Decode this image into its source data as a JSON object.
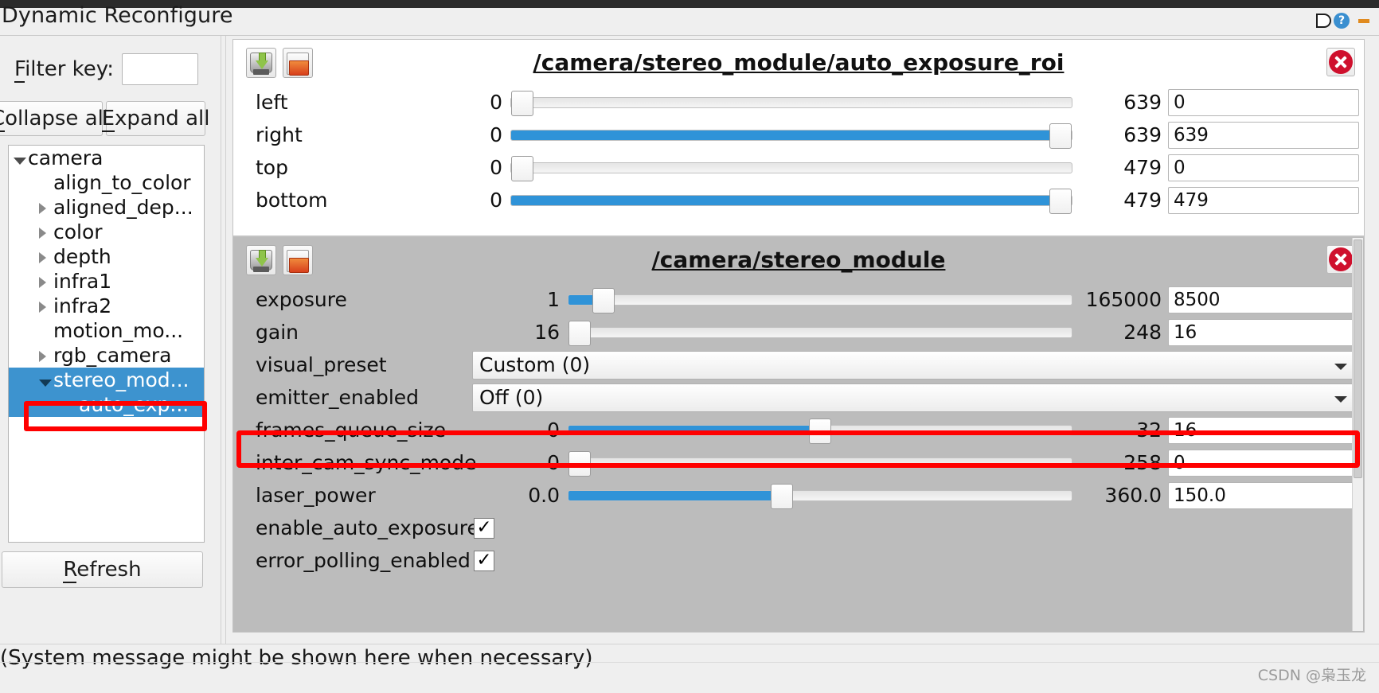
{
  "window": {
    "title": "Dynamic Reconfigure",
    "float_icon": "float-window-icon",
    "help_icon": "help-icon",
    "help_glyph": "?"
  },
  "sidebar": {
    "filter_label": "Filter key:",
    "filter_value": "",
    "filter_placeholder": "",
    "collapse_label": "Collapse all",
    "expand_label": "Expand all",
    "refresh_label": "Refresh",
    "tree": [
      {
        "label": "camera",
        "indent": 0,
        "toggle": "down",
        "selected": false
      },
      {
        "label": "align_to_color",
        "indent": 1,
        "toggle": "none",
        "selected": false
      },
      {
        "label": "aligned_dep...",
        "indent": 1,
        "toggle": "right",
        "selected": false
      },
      {
        "label": "color",
        "indent": 1,
        "toggle": "right",
        "selected": false
      },
      {
        "label": "depth",
        "indent": 1,
        "toggle": "right",
        "selected": false
      },
      {
        "label": "infra1",
        "indent": 1,
        "toggle": "right",
        "selected": false
      },
      {
        "label": "infra2",
        "indent": 1,
        "toggle": "right",
        "selected": false
      },
      {
        "label": "motion_mo...",
        "indent": 1,
        "toggle": "none",
        "selected": false
      },
      {
        "label": "rgb_camera",
        "indent": 1,
        "toggle": "right",
        "selected": false
      },
      {
        "label": "stereo_mod...",
        "indent": 1,
        "toggle": "down",
        "selected": true
      },
      {
        "label": "auto_exp...",
        "indent": 2,
        "toggle": "none",
        "selected": true
      }
    ]
  },
  "groups": [
    {
      "title": "/camera/stereo_module/auto_exposure_roi",
      "save_icon": "save-disk-icon",
      "open_icon": "open-folder-icon",
      "close_icon": "close-icon",
      "rows": [
        {
          "kind": "slider",
          "name": "left",
          "min": "0",
          "max": "639",
          "value": "0",
          "pct": 0,
          "fill": 0
        },
        {
          "kind": "slider",
          "name": "right",
          "min": "0",
          "max": "639",
          "value": "639",
          "pct": 100,
          "fill": 100
        },
        {
          "kind": "slider",
          "name": "top",
          "min": "0",
          "max": "479",
          "value": "0",
          "pct": 0,
          "fill": 0
        },
        {
          "kind": "slider",
          "name": "bottom",
          "min": "0",
          "max": "479",
          "value": "479",
          "pct": 100,
          "fill": 100
        }
      ]
    },
    {
      "title": "/camera/stereo_module",
      "save_icon": "save-disk-icon",
      "open_icon": "open-folder-icon",
      "close_icon": "close-icon",
      "rows": [
        {
          "kind": "slider",
          "name": "exposure",
          "min": "1",
          "max": "165000",
          "value": "8500",
          "pct": 5,
          "fill": 5
        },
        {
          "kind": "slider",
          "name": "gain",
          "min": "16",
          "max": "248",
          "value": "16",
          "pct": 0,
          "fill": 0
        },
        {
          "kind": "combo",
          "name": "visual_preset",
          "value": "Custom (0)"
        },
        {
          "kind": "combo",
          "name": "emitter_enabled",
          "value": "Off (0)",
          "highlight": true
        },
        {
          "kind": "slider",
          "name": "frames_queue_size",
          "min": "0",
          "max": "32",
          "value": "16",
          "pct": 50,
          "fill": 50
        },
        {
          "kind": "slider",
          "name": "inter_cam_sync_mode",
          "min": "0",
          "max": "258",
          "value": "0",
          "pct": 0,
          "fill": 0
        },
        {
          "kind": "slider",
          "name": "laser_power",
          "min": "0.0",
          "max": "360.0",
          "value": "150.0",
          "pct": 42,
          "fill": 42
        },
        {
          "kind": "check",
          "name": "enable_auto_exposure",
          "checked": true,
          "glyph": "✓"
        },
        {
          "kind": "check",
          "name": "error_polling_enabled",
          "checked": true,
          "glyph": "✓"
        }
      ]
    }
  ],
  "status": {
    "message": "(System message might be shown here when necessary)",
    "watermark": "CSDN @枭玉龙"
  }
}
